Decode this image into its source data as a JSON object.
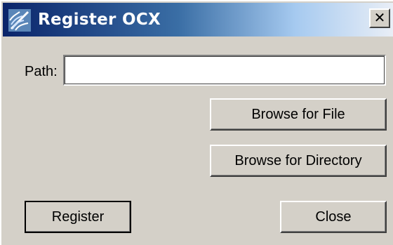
{
  "window": {
    "title": "Register OCX",
    "close_glyph": "✕"
  },
  "form": {
    "path_label": "Path:",
    "path_value": ""
  },
  "buttons": {
    "browse_file": "Browse for File",
    "browse_directory": "Browse for Directory",
    "register": "Register",
    "close": "Close"
  },
  "icons": {
    "app": "spiral-app-icon"
  },
  "colors": {
    "face": "#d4d0c8",
    "titlebar_start": "#0a246a",
    "titlebar_end": "#a6caf0"
  }
}
